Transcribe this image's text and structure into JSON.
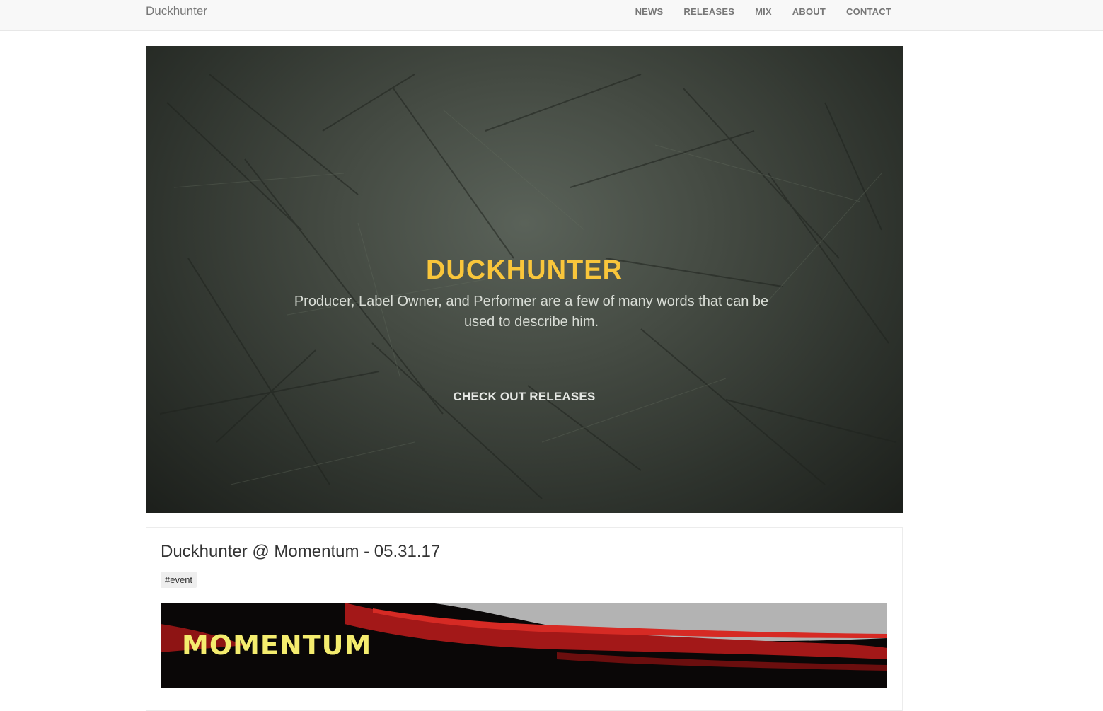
{
  "navbar": {
    "brand": "Duckhunter",
    "links": [
      "NEWS",
      "RELEASES",
      "MIX",
      "ABOUT",
      "CONTACT"
    ]
  },
  "hero": {
    "title": "DUCKHUNTER",
    "subtitle": "Producer, Label Owner, and Performer are a few of many words that can be used to describe him.",
    "button": "CHECK OUT RELEASES"
  },
  "post": {
    "title": "Duckhunter @ Momentum - 05.31.17",
    "tag": "#event",
    "image_text": "MOMENTUM"
  },
  "colors": {
    "accent": "#f9c63b",
    "navbar_bg": "#f8f8f8",
    "nav_text": "#777777"
  }
}
